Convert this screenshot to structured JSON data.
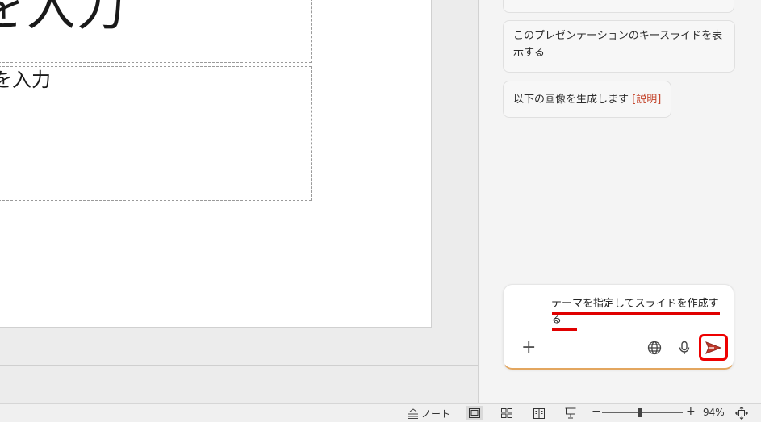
{
  "slide": {
    "title_placeholder": "を入力",
    "body_placeholder": "を入力"
  },
  "copilot": {
    "suggestions": [
      {
        "text": "このプレゼンテーションのキースライドを表示する"
      },
      {
        "text": "以下の画像を生成します",
        "link": "[説明]"
      }
    ],
    "composer": {
      "value": "テーマを指定してスライドを作成する"
    },
    "icons": {
      "add": "plus-icon",
      "web": "globe-icon",
      "voice": "microphone-icon",
      "send": "send-icon"
    },
    "accent_color": "#c4442b",
    "highlight_color": "#e00000"
  },
  "statusbar": {
    "notes_label": "ノート",
    "zoom_minus": "−",
    "zoom_plus": "+",
    "zoom_level": "94%",
    "zoom_fraction": 0.47
  }
}
